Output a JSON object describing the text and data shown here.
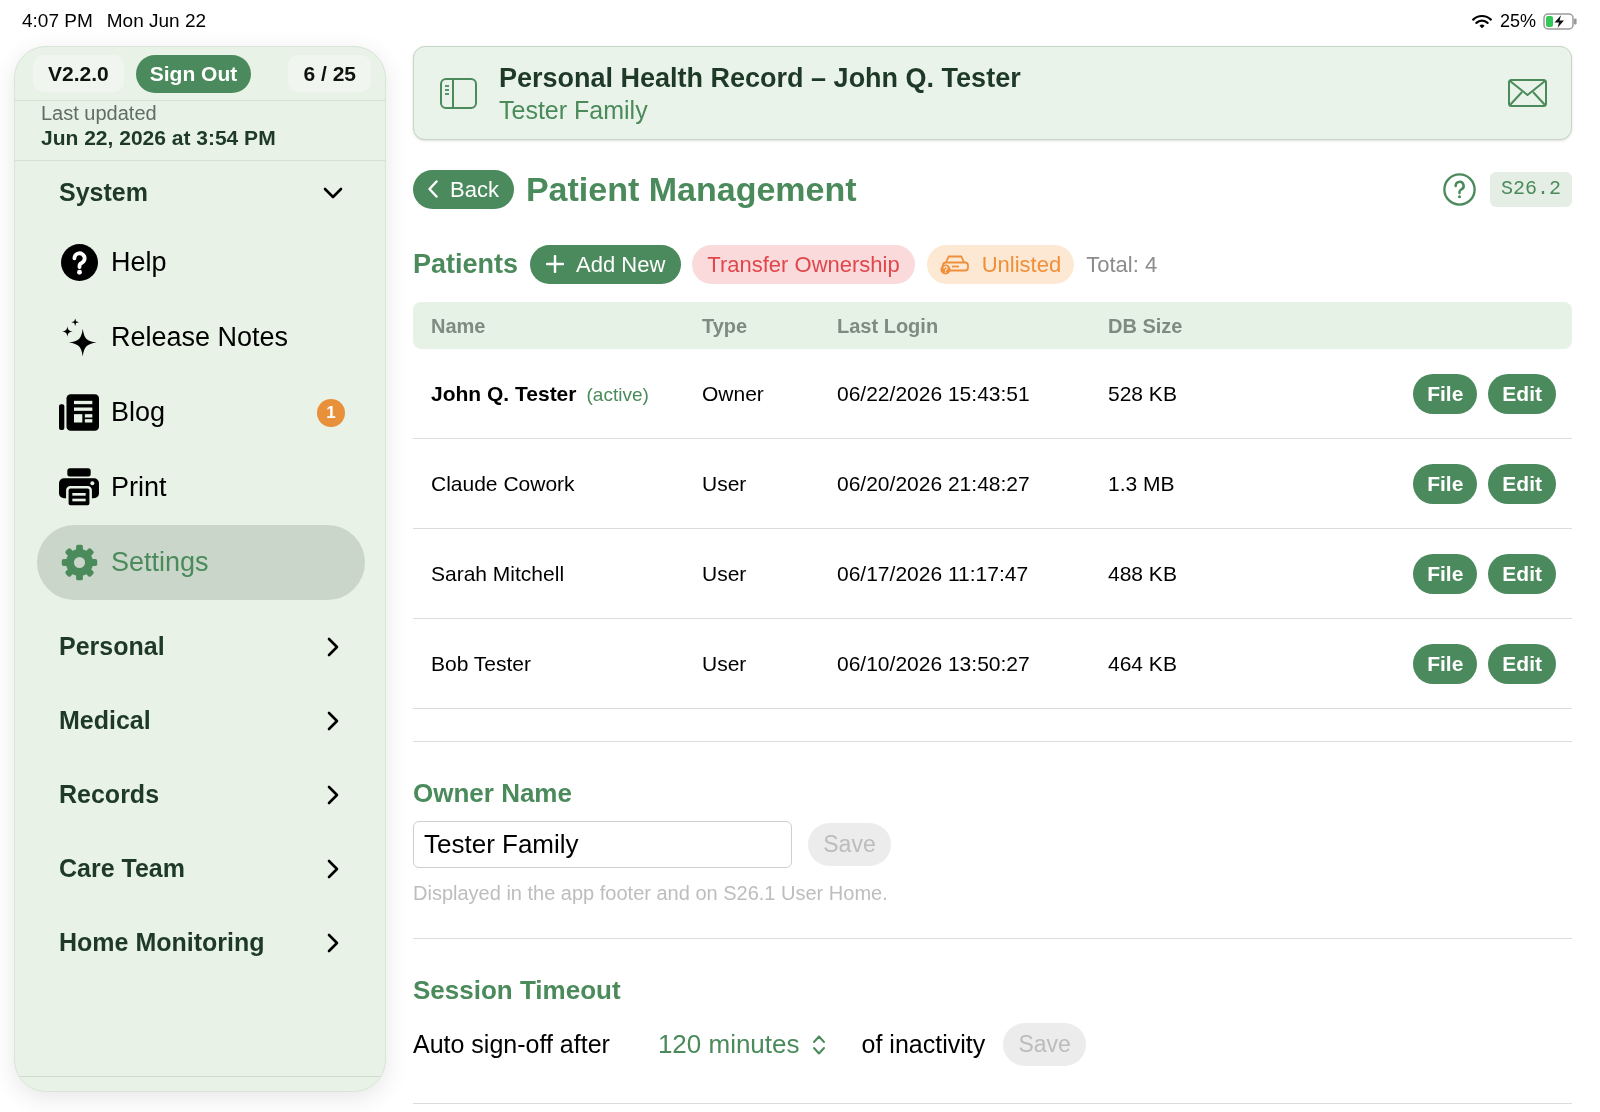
{
  "status_bar": {
    "time": "4:07 PM",
    "date": "Mon Jun 22",
    "battery": "25%"
  },
  "sidebar": {
    "version": "V2.2.0",
    "sign_out": "Sign Out",
    "counter": "6 / 25",
    "last_updated": {
      "label": "Last updated",
      "value": "Jun 22, 2026 at 3:54 PM"
    },
    "sections": [
      {
        "label": "System",
        "expanded": true,
        "children": [
          {
            "label": "Help",
            "selected": false
          },
          {
            "label": "Release Notes",
            "selected": false
          },
          {
            "label": "Blog",
            "selected": false,
            "badge": "1"
          },
          {
            "label": "Print",
            "selected": false
          },
          {
            "label": "Settings",
            "selected": true
          }
        ]
      },
      {
        "label": "Personal",
        "expanded": false
      },
      {
        "label": "Medical",
        "expanded": false
      },
      {
        "label": "Records",
        "expanded": false
      },
      {
        "label": "Care Team",
        "expanded": false
      },
      {
        "label": "Home Monitoring",
        "expanded": false
      }
    ]
  },
  "header": {
    "title": "Personal Health Record – John Q. Tester",
    "subtitle": "Tester Family"
  },
  "page": {
    "back": "Back",
    "title": "Patient Management",
    "screen_code": "S26.2"
  },
  "patients": {
    "heading": "Patients",
    "add_new": "Add New",
    "transfer": "Transfer Ownership",
    "unlisted": "Unlisted",
    "total": "Total: 4",
    "table": {
      "columns": [
        "Name",
        "Type",
        "Last Login",
        "DB Size"
      ],
      "rows": [
        {
          "name": "John Q. Tester",
          "note": "(active)",
          "current": true,
          "type": "Owner",
          "last_login": "06/22/2026 15:43:51",
          "db_size": "528 KB",
          "actions": [
            "File",
            "Edit"
          ]
        },
        {
          "name": "Claude Cowork",
          "current": false,
          "type": "User",
          "last_login": "06/20/2026 21:48:27",
          "db_size": "1.3 MB",
          "actions": [
            "File",
            "Edit"
          ]
        },
        {
          "name": "Sarah Mitchell",
          "current": false,
          "type": "User",
          "last_login": "06/17/2026 11:17:47",
          "db_size": "488 KB",
          "actions": [
            "File",
            "Edit"
          ]
        },
        {
          "name": "Bob Tester",
          "current": false,
          "type": "User",
          "last_login": "06/10/2026 13:50:27",
          "db_size": "464 KB",
          "actions": [
            "File",
            "Edit"
          ]
        }
      ]
    }
  },
  "owner_name": {
    "heading": "Owner Name",
    "value": "Tester Family",
    "save": {
      "label": "Save",
      "disabled": true
    },
    "hint": "Displayed in the app footer and on S26.1 User Home."
  },
  "session_timeout": {
    "heading": "Session Timeout",
    "prefix": "Auto sign-off after",
    "value": "120 minutes",
    "suffix": "of inactivity",
    "save": {
      "label": "Save",
      "disabled": true
    }
  }
}
